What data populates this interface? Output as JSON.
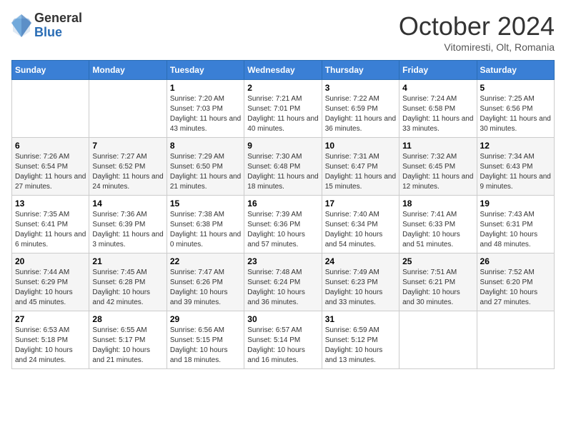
{
  "header": {
    "logo": {
      "general": "General",
      "blue": "Blue"
    },
    "title": "October 2024",
    "subtitle": "Vitomiresti, Olt, Romania"
  },
  "weekdays": [
    "Sunday",
    "Monday",
    "Tuesday",
    "Wednesday",
    "Thursday",
    "Friday",
    "Saturday"
  ],
  "weeks": [
    [
      {
        "day": "",
        "sunrise": "",
        "sunset": "",
        "daylight": ""
      },
      {
        "day": "",
        "sunrise": "",
        "sunset": "",
        "daylight": ""
      },
      {
        "day": "1",
        "sunrise": "Sunrise: 7:20 AM",
        "sunset": "Sunset: 7:03 PM",
        "daylight": "Daylight: 11 hours and 43 minutes."
      },
      {
        "day": "2",
        "sunrise": "Sunrise: 7:21 AM",
        "sunset": "Sunset: 7:01 PM",
        "daylight": "Daylight: 11 hours and 40 minutes."
      },
      {
        "day": "3",
        "sunrise": "Sunrise: 7:22 AM",
        "sunset": "Sunset: 6:59 PM",
        "daylight": "Daylight: 11 hours and 36 minutes."
      },
      {
        "day": "4",
        "sunrise": "Sunrise: 7:24 AM",
        "sunset": "Sunset: 6:58 PM",
        "daylight": "Daylight: 11 hours and 33 minutes."
      },
      {
        "day": "5",
        "sunrise": "Sunrise: 7:25 AM",
        "sunset": "Sunset: 6:56 PM",
        "daylight": "Daylight: 11 hours and 30 minutes."
      }
    ],
    [
      {
        "day": "6",
        "sunrise": "Sunrise: 7:26 AM",
        "sunset": "Sunset: 6:54 PM",
        "daylight": "Daylight: 11 hours and 27 minutes."
      },
      {
        "day": "7",
        "sunrise": "Sunrise: 7:27 AM",
        "sunset": "Sunset: 6:52 PM",
        "daylight": "Daylight: 11 hours and 24 minutes."
      },
      {
        "day": "8",
        "sunrise": "Sunrise: 7:29 AM",
        "sunset": "Sunset: 6:50 PM",
        "daylight": "Daylight: 11 hours and 21 minutes."
      },
      {
        "day": "9",
        "sunrise": "Sunrise: 7:30 AM",
        "sunset": "Sunset: 6:48 PM",
        "daylight": "Daylight: 11 hours and 18 minutes."
      },
      {
        "day": "10",
        "sunrise": "Sunrise: 7:31 AM",
        "sunset": "Sunset: 6:47 PM",
        "daylight": "Daylight: 11 hours and 15 minutes."
      },
      {
        "day": "11",
        "sunrise": "Sunrise: 7:32 AM",
        "sunset": "Sunset: 6:45 PM",
        "daylight": "Daylight: 11 hours and 12 minutes."
      },
      {
        "day": "12",
        "sunrise": "Sunrise: 7:34 AM",
        "sunset": "Sunset: 6:43 PM",
        "daylight": "Daylight: 11 hours and 9 minutes."
      }
    ],
    [
      {
        "day": "13",
        "sunrise": "Sunrise: 7:35 AM",
        "sunset": "Sunset: 6:41 PM",
        "daylight": "Daylight: 11 hours and 6 minutes."
      },
      {
        "day": "14",
        "sunrise": "Sunrise: 7:36 AM",
        "sunset": "Sunset: 6:39 PM",
        "daylight": "Daylight: 11 hours and 3 minutes."
      },
      {
        "day": "15",
        "sunrise": "Sunrise: 7:38 AM",
        "sunset": "Sunset: 6:38 PM",
        "daylight": "Daylight: 11 hours and 0 minutes."
      },
      {
        "day": "16",
        "sunrise": "Sunrise: 7:39 AM",
        "sunset": "Sunset: 6:36 PM",
        "daylight": "Daylight: 10 hours and 57 minutes."
      },
      {
        "day": "17",
        "sunrise": "Sunrise: 7:40 AM",
        "sunset": "Sunset: 6:34 PM",
        "daylight": "Daylight: 10 hours and 54 minutes."
      },
      {
        "day": "18",
        "sunrise": "Sunrise: 7:41 AM",
        "sunset": "Sunset: 6:33 PM",
        "daylight": "Daylight: 10 hours and 51 minutes."
      },
      {
        "day": "19",
        "sunrise": "Sunrise: 7:43 AM",
        "sunset": "Sunset: 6:31 PM",
        "daylight": "Daylight: 10 hours and 48 minutes."
      }
    ],
    [
      {
        "day": "20",
        "sunrise": "Sunrise: 7:44 AM",
        "sunset": "Sunset: 6:29 PM",
        "daylight": "Daylight: 10 hours and 45 minutes."
      },
      {
        "day": "21",
        "sunrise": "Sunrise: 7:45 AM",
        "sunset": "Sunset: 6:28 PM",
        "daylight": "Daylight: 10 hours and 42 minutes."
      },
      {
        "day": "22",
        "sunrise": "Sunrise: 7:47 AM",
        "sunset": "Sunset: 6:26 PM",
        "daylight": "Daylight: 10 hours and 39 minutes."
      },
      {
        "day": "23",
        "sunrise": "Sunrise: 7:48 AM",
        "sunset": "Sunset: 6:24 PM",
        "daylight": "Daylight: 10 hours and 36 minutes."
      },
      {
        "day": "24",
        "sunrise": "Sunrise: 7:49 AM",
        "sunset": "Sunset: 6:23 PM",
        "daylight": "Daylight: 10 hours and 33 minutes."
      },
      {
        "day": "25",
        "sunrise": "Sunrise: 7:51 AM",
        "sunset": "Sunset: 6:21 PM",
        "daylight": "Daylight: 10 hours and 30 minutes."
      },
      {
        "day": "26",
        "sunrise": "Sunrise: 7:52 AM",
        "sunset": "Sunset: 6:20 PM",
        "daylight": "Daylight: 10 hours and 27 minutes."
      }
    ],
    [
      {
        "day": "27",
        "sunrise": "Sunrise: 6:53 AM",
        "sunset": "Sunset: 5:18 PM",
        "daylight": "Daylight: 10 hours and 24 minutes."
      },
      {
        "day": "28",
        "sunrise": "Sunrise: 6:55 AM",
        "sunset": "Sunset: 5:17 PM",
        "daylight": "Daylight: 10 hours and 21 minutes."
      },
      {
        "day": "29",
        "sunrise": "Sunrise: 6:56 AM",
        "sunset": "Sunset: 5:15 PM",
        "daylight": "Daylight: 10 hours and 18 minutes."
      },
      {
        "day": "30",
        "sunrise": "Sunrise: 6:57 AM",
        "sunset": "Sunset: 5:14 PM",
        "daylight": "Daylight: 10 hours and 16 minutes."
      },
      {
        "day": "31",
        "sunrise": "Sunrise: 6:59 AM",
        "sunset": "Sunset: 5:12 PM",
        "daylight": "Daylight: 10 hours and 13 minutes."
      },
      {
        "day": "",
        "sunrise": "",
        "sunset": "",
        "daylight": ""
      },
      {
        "day": "",
        "sunrise": "",
        "sunset": "",
        "daylight": ""
      }
    ]
  ]
}
